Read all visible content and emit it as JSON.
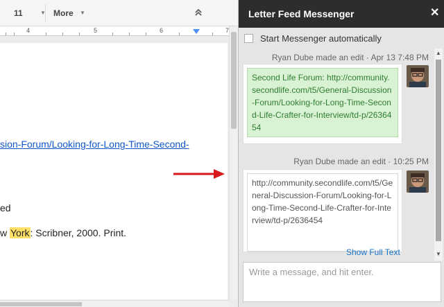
{
  "toolbar": {
    "font_size": "11",
    "more_label": "More",
    "collapse_icon": "double-chevron-up-icon"
  },
  "ruler": {
    "labels": [
      "4",
      "5",
      "6",
      "7"
    ]
  },
  "document": {
    "link_text": "sion-Forum/Looking-for-Long-Time-Second-",
    "line_ed": "ed",
    "cite_before": "w ",
    "cite_highlight": "York",
    "cite_after": ": Scribner, 2000. Print."
  },
  "colors": {
    "panel_header": "#2d2d2d",
    "link": "#1155cc",
    "highlight": "#ffe066",
    "green_bubble": "#d9f2d3",
    "arrow": "#d7191c"
  },
  "panel": {
    "title": "Letter Feed Messenger",
    "close_icon": "close-icon",
    "auto_start_label": "Start Messenger automatically",
    "messages": [
      {
        "meta": "Ryan Dube made an edit · Apr 13 7:48 PM",
        "text": "Second Life Forum: http://community.secondlife.com/t5/General-Discussion-Forum/Looking-for-Long-Time-Second-Life-Crafter-for-Interview/td-p/2636454",
        "style": "green"
      },
      {
        "meta": "Ryan Dube made an edit · 10:25 PM",
        "text": "http://community.secondlife.com/t5/General-Discussion-Forum/Looking-for-Long-Time-Second-Life-Crafter-for-Interview/td-p/2636454",
        "style": "white"
      }
    ],
    "show_full_text": "Show Full Text",
    "input_placeholder": "Write a message, and hit enter."
  }
}
